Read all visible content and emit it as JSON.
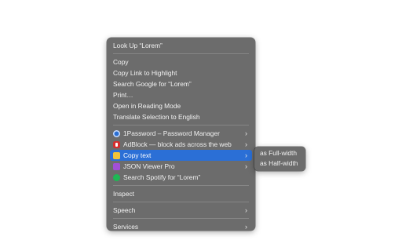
{
  "menu": {
    "look_up": "Look Up “Lorem”",
    "copy": "Copy",
    "copy_link": "Copy Link to Highlight",
    "search_google": "Search Google for “Lorem”",
    "print": "Print…",
    "reading_mode": "Open in Reading Mode",
    "translate": "Translate Selection to English",
    "extensions": [
      {
        "label": "1Password – Password Manager",
        "icon": "1password-icon",
        "color": "#2a6fd4",
        "has_submenu": true
      },
      {
        "label": "AdBlock — block ads across the web",
        "icon": "adblock-icon",
        "color": "#d62d2d",
        "has_submenu": true
      },
      {
        "label": "Copy text",
        "icon": "copy-text-icon",
        "color": "#f0c33a",
        "has_submenu": true,
        "highlighted": true
      },
      {
        "label": "JSON Viewer Pro",
        "icon": "json-viewer-icon",
        "color": "#a24fd8",
        "has_submenu": true
      },
      {
        "label": "Search Spotify for “Lorem”",
        "icon": "spotify-icon",
        "color": "#1db954",
        "has_submenu": false
      }
    ],
    "inspect": "Inspect",
    "speech": "Speech",
    "services": "Services",
    "chevron": "›"
  },
  "submenu": {
    "full_width": "as Full-width",
    "half_width": "as Half-width"
  },
  "colors": {
    "menu_bg": "#6c6c6c",
    "highlight": "#2b6fd6"
  }
}
